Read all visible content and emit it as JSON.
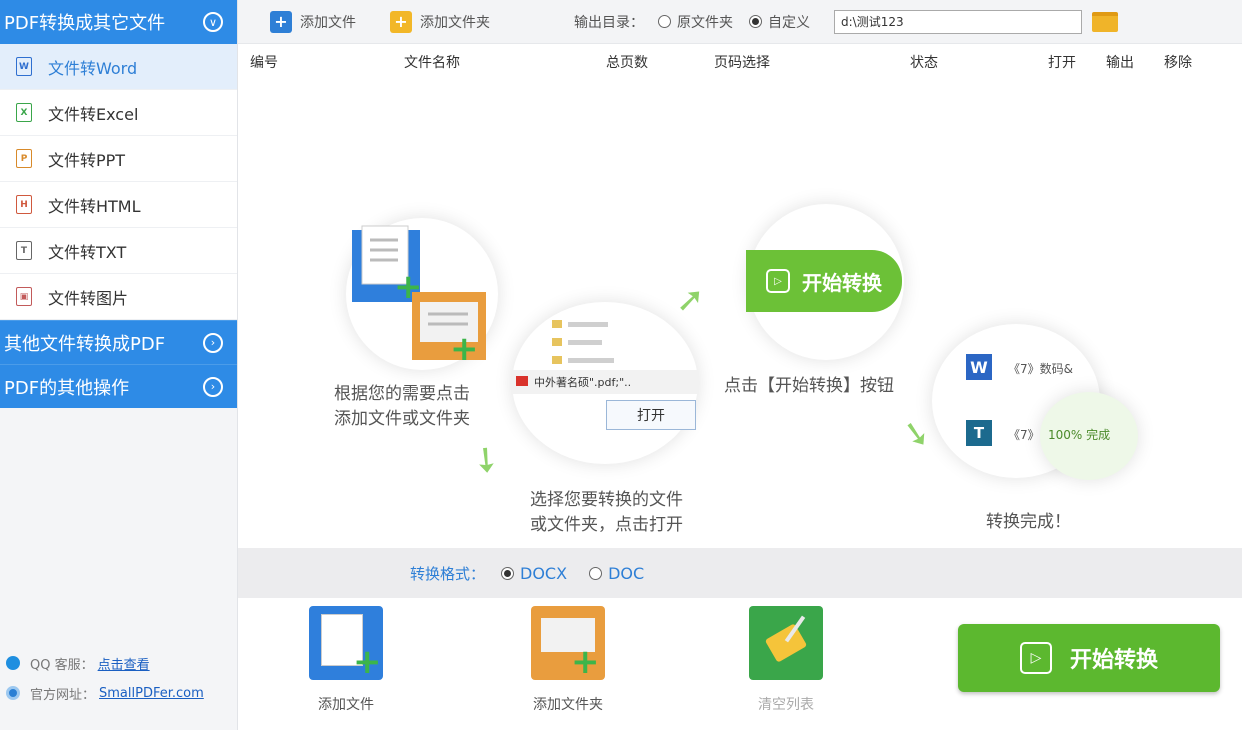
{
  "sidebar": {
    "section1": {
      "label": "PDF转换成其它文件"
    },
    "items": [
      {
        "label": "文件转Word",
        "icon": "word-file-icon"
      },
      {
        "label": "文件转Excel",
        "icon": "excel-file-icon"
      },
      {
        "label": "文件转PPT",
        "icon": "ppt-file-icon"
      },
      {
        "label": "文件转HTML",
        "icon": "html-file-icon"
      },
      {
        "label": "文件转TXT",
        "icon": "txt-file-icon"
      },
      {
        "label": "文件转图片",
        "icon": "image-file-icon"
      }
    ],
    "section2": {
      "label": "其他文件转换成PDF"
    },
    "section3": {
      "label": "PDF的其他操作"
    },
    "footer": {
      "qq_label": "QQ 客服：",
      "qq_link": "点击查看",
      "site_label": "官方网址：",
      "site_link": "SmallPDFer.com"
    }
  },
  "toolbar": {
    "add_file": "添加文件",
    "add_folder": "添加文件夹",
    "output_label": "输出目录：",
    "opt_original": "原文件夹",
    "opt_custom": "自定义",
    "path_value": "d:\\测试123"
  },
  "table": {
    "headers": [
      "编号",
      "文件名称",
      "总页数",
      "页码选择",
      "状态",
      "打开",
      "输出",
      "移除"
    ]
  },
  "guide": {
    "step1": "根据您的需要点击\n添加文件或文件夹",
    "step2": "选择您要转换的文件\n或文件夹，点击打开",
    "step2_file": "中外著名硕\".pdf;\"..",
    "step2_open": "打开",
    "step3_btn": "开始转换",
    "step3": "点击【开始转换】按钮",
    "step4_row1": "《7》数码&",
    "step4_row2": "《7》",
    "step4_progress": "100% 完成",
    "step4": "转换完成！"
  },
  "format": {
    "label": "转换格式：",
    "opt1": "DOCX",
    "opt2": "DOC"
  },
  "bottom": {
    "add_file": "添加文件",
    "add_folder": "添加文件夹",
    "clear": "清空列表",
    "start": "开始转换"
  },
  "colors": {
    "accent": "#2e8be6",
    "green": "#5cb82f"
  }
}
